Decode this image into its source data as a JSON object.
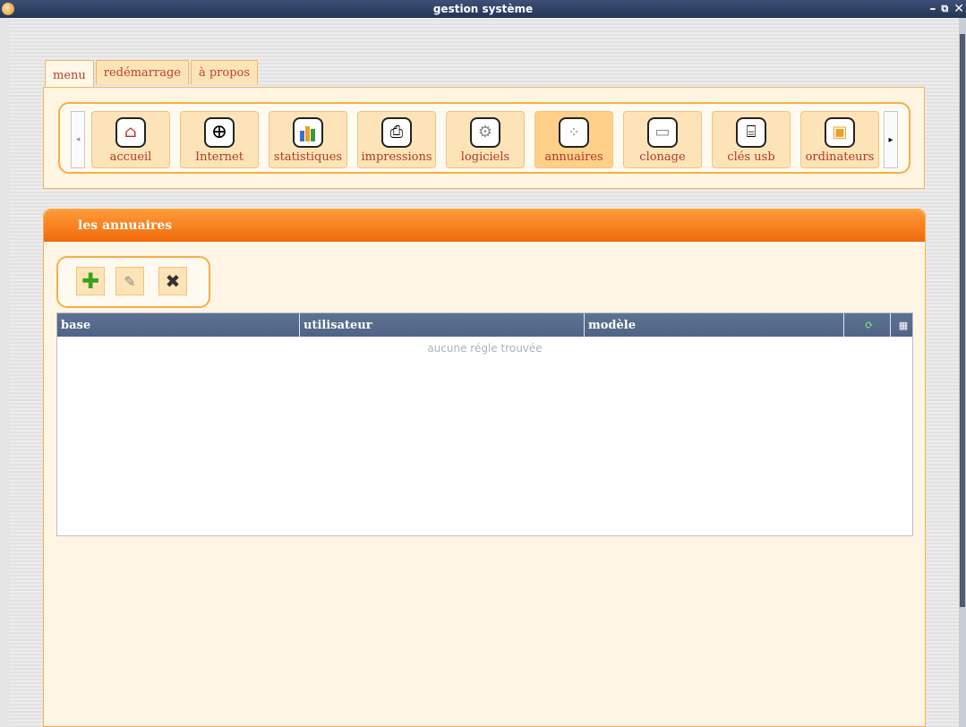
{
  "window": {
    "title": "gestion système"
  },
  "tabs": [
    {
      "label": "menu",
      "active": true
    },
    {
      "label": "redémarrage",
      "active": false
    },
    {
      "label": "à propos",
      "active": false
    }
  ],
  "menu_items": [
    {
      "label": "accueil",
      "icon": "home-icon",
      "glyph": "⌂",
      "selected": false
    },
    {
      "label": "Internet",
      "icon": "globe-icon",
      "glyph": "🌐",
      "selected": false
    },
    {
      "label": "statistiques",
      "icon": "bar-chart-icon",
      "glyph": "▮",
      "selected": false
    },
    {
      "label": "impressions",
      "icon": "printer-icon",
      "glyph": "⎙",
      "selected": false
    },
    {
      "label": "logiciels",
      "icon": "gear-icon",
      "glyph": "⚙",
      "selected": false
    },
    {
      "label": "annuaires",
      "icon": "network-icon",
      "glyph": "⁘",
      "selected": true
    },
    {
      "label": "clonage",
      "icon": "disk-icon",
      "glyph": "▭",
      "selected": false
    },
    {
      "label": "clés usb",
      "icon": "usb-key-icon",
      "glyph": "⌸",
      "selected": false
    },
    {
      "label": "ordinateurs",
      "icon": "monitor-icon",
      "glyph": "▣",
      "selected": false
    }
  ],
  "panel": {
    "title": "les annuaires",
    "grid": {
      "columns": [
        "base",
        "utilisateur",
        "modèle"
      ],
      "empty_message": "aucune régle trouvée"
    }
  },
  "colors": {
    "accent": "#f07a1a",
    "tab_text": "#c0402a",
    "grid_header": "#5a6f90"
  }
}
